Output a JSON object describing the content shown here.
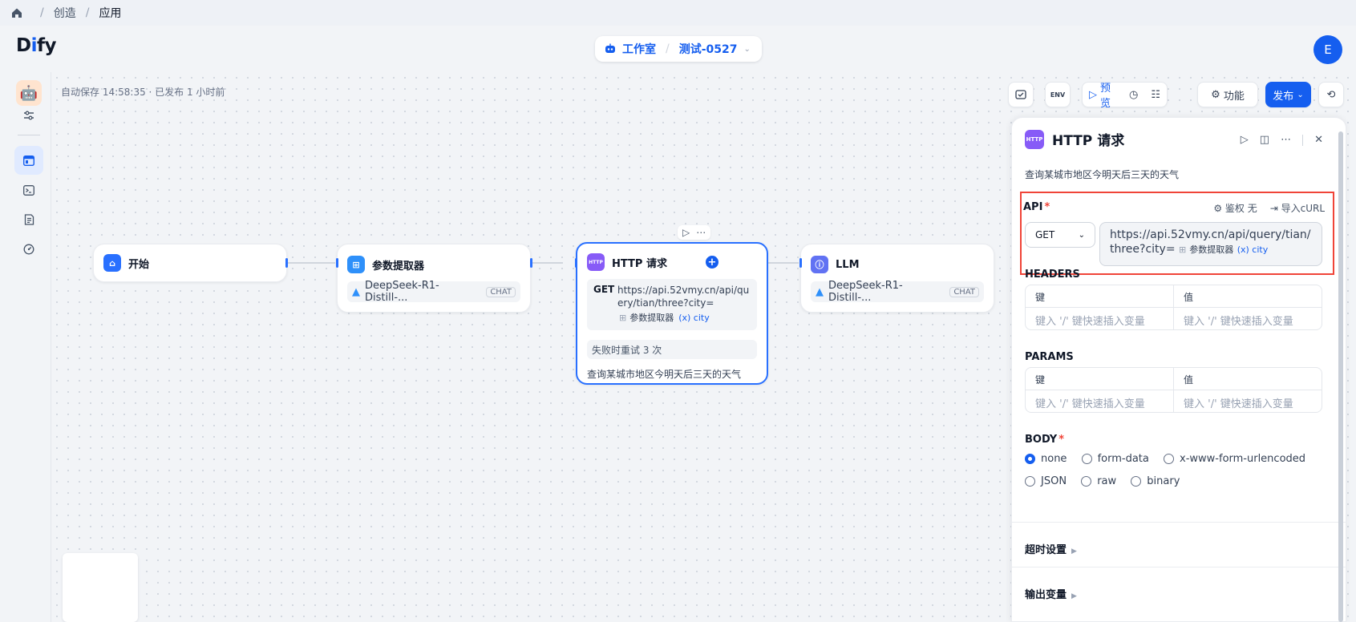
{
  "breadcrumb": {
    "items": [
      "创造",
      "应用"
    ]
  },
  "header": {
    "logo_prefix": "D",
    "logo_i": "i",
    "logo_suffix": "fy",
    "studio_label": "工作室",
    "app_name": "测试-0527",
    "avatar_letter": "E"
  },
  "canvas": {
    "autosave": "自动保存 14:58:35 · 已发布 1 小时前",
    "toolbar": {
      "env_label": "ENV",
      "preview_label": "预览",
      "features_label": "功能",
      "publish_label": "发布"
    }
  },
  "nodes": {
    "start": {
      "title": "开始"
    },
    "param_extractor": {
      "title": "参数提取器",
      "model": "DeepSeek-R1-Distill-...",
      "tag": "CHAT"
    },
    "http": {
      "title": "HTTP 请求",
      "method": "GET",
      "url": "https://api.52vmy.cn/api/query/tian/three?city=",
      "var_source": "参数提取器",
      "var_name": "(x) city",
      "retry": "失败时重试 3 次",
      "desc": "查询某城市地区今明天后三天的天气"
    },
    "llm": {
      "title": "LLM",
      "model": "DeepSeek-R1-Distill-...",
      "tag": "CHAT"
    }
  },
  "panel": {
    "title": "HTTP 请求",
    "icon_text": "HTTP",
    "desc": "查询某城市地区今明天后三天的天气",
    "api_label": "API",
    "auth_label": "鉴权 无",
    "import_label": "导入cURL",
    "method": "GET",
    "url": "https://api.52vmy.cn/api/query/tian/three?city=",
    "var_source": "参数提取器",
    "var_name": "(x) city",
    "headers_label": "HEADERS",
    "params_label": "PARAMS",
    "key_header": "键",
    "value_header": "值",
    "key_placeholder": "键入 '/' 键快速插入变量",
    "value_placeholder": "键入 '/' 键快速插入变量",
    "body_label": "BODY",
    "body_options": [
      "none",
      "form-data",
      "x-www-form-urlencoded",
      "JSON",
      "raw",
      "binary"
    ],
    "body_selected": "none",
    "timeout_label": "超时设置",
    "output_label": "输出变量"
  },
  "colors": {
    "accent": "#155eef",
    "required": "#f04438",
    "http_icon": "#875bf7",
    "start_icon": "#2970ff",
    "llm_icon": "#6172f3"
  }
}
